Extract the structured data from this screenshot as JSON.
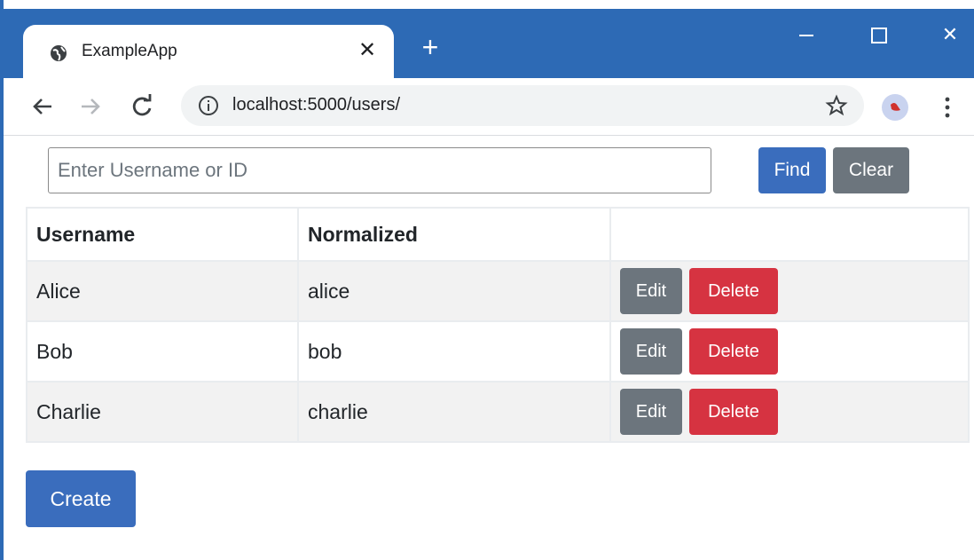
{
  "browser": {
    "tab_title": "ExampleApp",
    "url": "localhost:5000/users/"
  },
  "search": {
    "placeholder": "Enter Username or ID",
    "find_label": "Find",
    "clear_label": "Clear"
  },
  "table": {
    "headers": [
      "Username",
      "Normalized",
      ""
    ],
    "rows": [
      {
        "username": "Alice",
        "normalized": "alice",
        "edit_label": "Edit",
        "delete_label": "Delete"
      },
      {
        "username": "Bob",
        "normalized": "bob",
        "edit_label": "Edit",
        "delete_label": "Delete"
      },
      {
        "username": "Charlie",
        "normalized": "charlie",
        "edit_label": "Edit",
        "delete_label": "Delete"
      }
    ]
  },
  "create_label": "Create",
  "colors": {
    "titlebar": "#2d6ab5",
    "primary": "#3a6dbd",
    "secondary": "#6c757d",
    "danger": "#d63341"
  }
}
